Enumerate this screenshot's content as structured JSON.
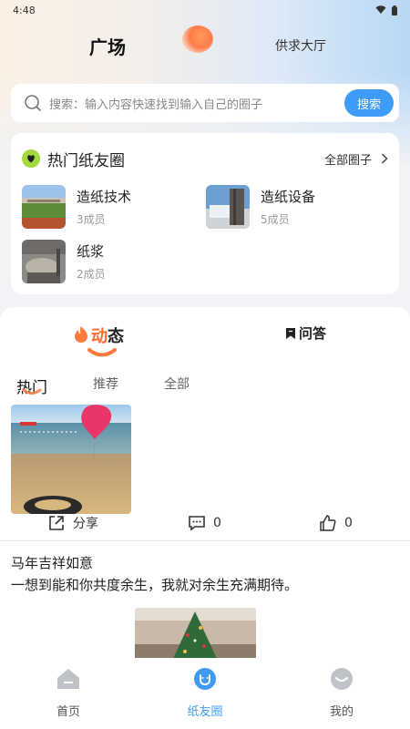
{
  "status_bar": {
    "time": "4:48"
  },
  "header": {
    "title": "广场",
    "secondary": "供求大厅"
  },
  "search": {
    "placeholder": "搜索：输入内容快速找到输入自己的圈子",
    "button": "搜索"
  },
  "hot_circles": {
    "title": "热门纸友圈",
    "all_link": "全部圈子",
    "items": [
      {
        "name": "造纸技术",
        "members": "3成员"
      },
      {
        "name": "造纸设备",
        "members": "5成员"
      },
      {
        "name": "纸浆",
        "members": "2成员"
      }
    ]
  },
  "feed": {
    "segments": {
      "dynamic_1": "动",
      "dynamic_2": "态",
      "qa": "问答"
    },
    "tabs": [
      "热门",
      "推荐",
      "全部"
    ],
    "post": {
      "share": "分享",
      "comment_count": "0",
      "like_count": "0",
      "title": "马年吉祥如意",
      "body": "一想到能和你共度余生，我就对余生充满期待。"
    }
  },
  "tabbar": {
    "items": [
      {
        "label": "首页"
      },
      {
        "label": "纸友圈"
      },
      {
        "label": "我的"
      }
    ],
    "active_index": 1,
    "active_color": "#3e9cf6"
  },
  "colors": {
    "accent": "#3e9cf6",
    "brand_orange": "#ff6a2e"
  }
}
